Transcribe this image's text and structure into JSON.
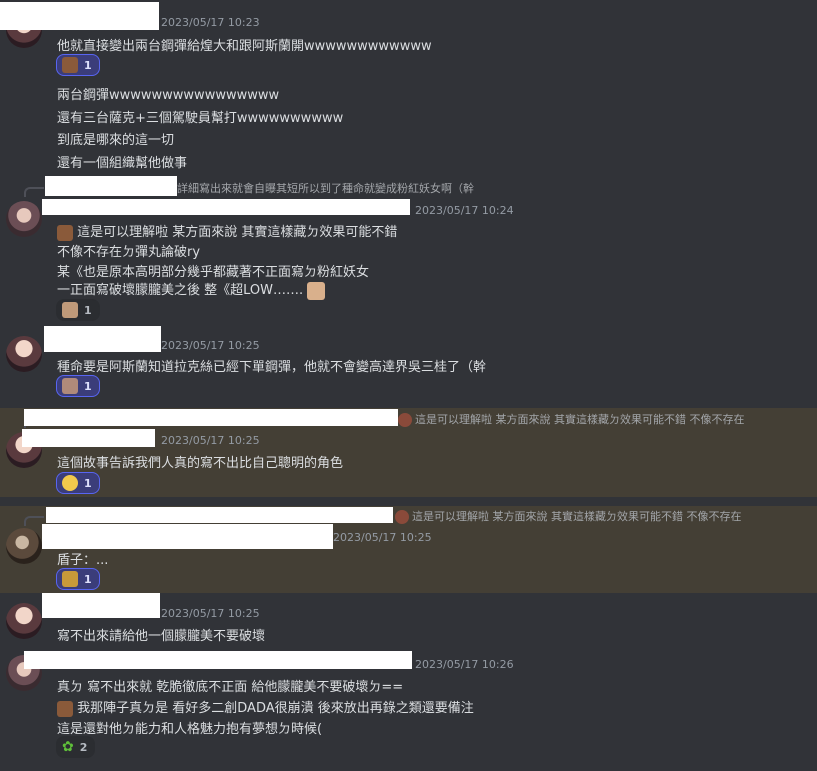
{
  "colors": {
    "background": "#313338",
    "highlight": "#443f35",
    "reaction_active": "#3b3d7a",
    "accent": "#5865f2"
  },
  "messages": [
    {
      "timestamp": "2023/05/17 10:23",
      "lines": [
        "他就直接變出兩台鋼彈給煌大和跟阿斯蘭開wwwwwwwwwwww"
      ],
      "reaction_count": "1",
      "more": [
        "兩台鋼彈wwwwwwwwwwwwwwww",
        "還有三台薩克+三個駕駛員幫打wwwwwwwwww",
        "到底是哪來的這一切",
        "還有一個組織幫他做事"
      ]
    },
    {
      "reply_preview": "詳細寫出來就會自曝其短所以到了種命就變成粉紅妖女啊（幹",
      "timestamp": "2023/05/17 10:24",
      "lines": [
        "這是可以理解啦 某方面來說 其實這樣藏ㄉ效果可能不錯",
        "不像不存在ㄉ彈丸論破ry",
        "某《也是原本高明部分幾乎都藏著不正面寫ㄉ粉紅妖女",
        "一正面寫破壞朦朧美之後 整《超LOW……."
      ],
      "reaction_count": "1"
    },
    {
      "timestamp": "2023/05/17 10:25",
      "lines": [
        "種命要是阿斯蘭知道拉克絲已經下單鋼彈，他就不會變高達界吳三桂了（幹"
      ],
      "reaction_count": "1"
    },
    {
      "reply_preview": "這是可以理解啦 某方面來說 其實這樣藏ㄉ效果可能不錯 不像不存在",
      "timestamp": "2023/05/17 10:25",
      "lines": [
        "這個故事告訴我們人真的寫不出比自己聰明的角色"
      ],
      "reaction_count": "1"
    },
    {
      "reply_preview": "這是可以理解啦 某方面來說 其實這樣藏ㄉ效果可能不錯 不像不存在",
      "timestamp": "2023/05/17 10:25",
      "lines": [
        "盾子：..."
      ],
      "reaction_count": "1"
    },
    {
      "timestamp": "2023/05/17 10:25",
      "lines": [
        "寫不出來請給他一個朦朧美不要破壞"
      ]
    },
    {
      "timestamp": "2023/05/17 10:26",
      "lines": [
        "真ㄉ 寫不出來就 乾脆徹底不正面 給他朦朧美不要破壞ㄉ==",
        "我那陣子真ㄉ是 看好多二創DADA很崩潰 後來放出再錄之類還要備注",
        "這是還對他ㄉ能力和人格魅力抱有夢想ㄉ時候("
      ],
      "reaction_count": "2"
    }
  ]
}
